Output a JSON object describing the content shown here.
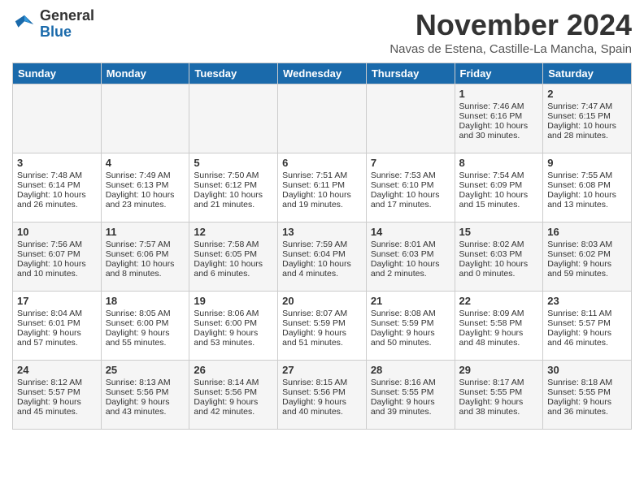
{
  "header": {
    "logo_line1": "General",
    "logo_line2": "Blue",
    "month": "November 2024",
    "location": "Navas de Estena, Castille-La Mancha, Spain"
  },
  "days_of_week": [
    "Sunday",
    "Monday",
    "Tuesday",
    "Wednesday",
    "Thursday",
    "Friday",
    "Saturday"
  ],
  "weeks": [
    [
      {
        "day": "",
        "sunrise": "",
        "sunset": "",
        "daylight": ""
      },
      {
        "day": "",
        "sunrise": "",
        "sunset": "",
        "daylight": ""
      },
      {
        "day": "",
        "sunrise": "",
        "sunset": "",
        "daylight": ""
      },
      {
        "day": "",
        "sunrise": "",
        "sunset": "",
        "daylight": ""
      },
      {
        "day": "",
        "sunrise": "",
        "sunset": "",
        "daylight": ""
      },
      {
        "day": "1",
        "sunrise": "Sunrise: 7:46 AM",
        "sunset": "Sunset: 6:16 PM",
        "daylight": "Daylight: 10 hours and 30 minutes."
      },
      {
        "day": "2",
        "sunrise": "Sunrise: 7:47 AM",
        "sunset": "Sunset: 6:15 PM",
        "daylight": "Daylight: 10 hours and 28 minutes."
      }
    ],
    [
      {
        "day": "3",
        "sunrise": "Sunrise: 7:48 AM",
        "sunset": "Sunset: 6:14 PM",
        "daylight": "Daylight: 10 hours and 26 minutes."
      },
      {
        "day": "4",
        "sunrise": "Sunrise: 7:49 AM",
        "sunset": "Sunset: 6:13 PM",
        "daylight": "Daylight: 10 hours and 23 minutes."
      },
      {
        "day": "5",
        "sunrise": "Sunrise: 7:50 AM",
        "sunset": "Sunset: 6:12 PM",
        "daylight": "Daylight: 10 hours and 21 minutes."
      },
      {
        "day": "6",
        "sunrise": "Sunrise: 7:51 AM",
        "sunset": "Sunset: 6:11 PM",
        "daylight": "Daylight: 10 hours and 19 minutes."
      },
      {
        "day": "7",
        "sunrise": "Sunrise: 7:53 AM",
        "sunset": "Sunset: 6:10 PM",
        "daylight": "Daylight: 10 hours and 17 minutes."
      },
      {
        "day": "8",
        "sunrise": "Sunrise: 7:54 AM",
        "sunset": "Sunset: 6:09 PM",
        "daylight": "Daylight: 10 hours and 15 minutes."
      },
      {
        "day": "9",
        "sunrise": "Sunrise: 7:55 AM",
        "sunset": "Sunset: 6:08 PM",
        "daylight": "Daylight: 10 hours and 13 minutes."
      }
    ],
    [
      {
        "day": "10",
        "sunrise": "Sunrise: 7:56 AM",
        "sunset": "Sunset: 6:07 PM",
        "daylight": "Daylight: 10 hours and 10 minutes."
      },
      {
        "day": "11",
        "sunrise": "Sunrise: 7:57 AM",
        "sunset": "Sunset: 6:06 PM",
        "daylight": "Daylight: 10 hours and 8 minutes."
      },
      {
        "day": "12",
        "sunrise": "Sunrise: 7:58 AM",
        "sunset": "Sunset: 6:05 PM",
        "daylight": "Daylight: 10 hours and 6 minutes."
      },
      {
        "day": "13",
        "sunrise": "Sunrise: 7:59 AM",
        "sunset": "Sunset: 6:04 PM",
        "daylight": "Daylight: 10 hours and 4 minutes."
      },
      {
        "day": "14",
        "sunrise": "Sunrise: 8:01 AM",
        "sunset": "Sunset: 6:03 PM",
        "daylight": "Daylight: 10 hours and 2 minutes."
      },
      {
        "day": "15",
        "sunrise": "Sunrise: 8:02 AM",
        "sunset": "Sunset: 6:03 PM",
        "daylight": "Daylight: 10 hours and 0 minutes."
      },
      {
        "day": "16",
        "sunrise": "Sunrise: 8:03 AM",
        "sunset": "Sunset: 6:02 PM",
        "daylight": "Daylight: 9 hours and 59 minutes."
      }
    ],
    [
      {
        "day": "17",
        "sunrise": "Sunrise: 8:04 AM",
        "sunset": "Sunset: 6:01 PM",
        "daylight": "Daylight: 9 hours and 57 minutes."
      },
      {
        "day": "18",
        "sunrise": "Sunrise: 8:05 AM",
        "sunset": "Sunset: 6:00 PM",
        "daylight": "Daylight: 9 hours and 55 minutes."
      },
      {
        "day": "19",
        "sunrise": "Sunrise: 8:06 AM",
        "sunset": "Sunset: 6:00 PM",
        "daylight": "Daylight: 9 hours and 53 minutes."
      },
      {
        "day": "20",
        "sunrise": "Sunrise: 8:07 AM",
        "sunset": "Sunset: 5:59 PM",
        "daylight": "Daylight: 9 hours and 51 minutes."
      },
      {
        "day": "21",
        "sunrise": "Sunrise: 8:08 AM",
        "sunset": "Sunset: 5:59 PM",
        "daylight": "Daylight: 9 hours and 50 minutes."
      },
      {
        "day": "22",
        "sunrise": "Sunrise: 8:09 AM",
        "sunset": "Sunset: 5:58 PM",
        "daylight": "Daylight: 9 hours and 48 minutes."
      },
      {
        "day": "23",
        "sunrise": "Sunrise: 8:11 AM",
        "sunset": "Sunset: 5:57 PM",
        "daylight": "Daylight: 9 hours and 46 minutes."
      }
    ],
    [
      {
        "day": "24",
        "sunrise": "Sunrise: 8:12 AM",
        "sunset": "Sunset: 5:57 PM",
        "daylight": "Daylight: 9 hours and 45 minutes."
      },
      {
        "day": "25",
        "sunrise": "Sunrise: 8:13 AM",
        "sunset": "Sunset: 5:56 PM",
        "daylight": "Daylight: 9 hours and 43 minutes."
      },
      {
        "day": "26",
        "sunrise": "Sunrise: 8:14 AM",
        "sunset": "Sunset: 5:56 PM",
        "daylight": "Daylight: 9 hours and 42 minutes."
      },
      {
        "day": "27",
        "sunrise": "Sunrise: 8:15 AM",
        "sunset": "Sunset: 5:56 PM",
        "daylight": "Daylight: 9 hours and 40 minutes."
      },
      {
        "day": "28",
        "sunrise": "Sunrise: 8:16 AM",
        "sunset": "Sunset: 5:55 PM",
        "daylight": "Daylight: 9 hours and 39 minutes."
      },
      {
        "day": "29",
        "sunrise": "Sunrise: 8:17 AM",
        "sunset": "Sunset: 5:55 PM",
        "daylight": "Daylight: 9 hours and 38 minutes."
      },
      {
        "day": "30",
        "sunrise": "Sunrise: 8:18 AM",
        "sunset": "Sunset: 5:55 PM",
        "daylight": "Daylight: 9 hours and 36 minutes."
      }
    ]
  ]
}
